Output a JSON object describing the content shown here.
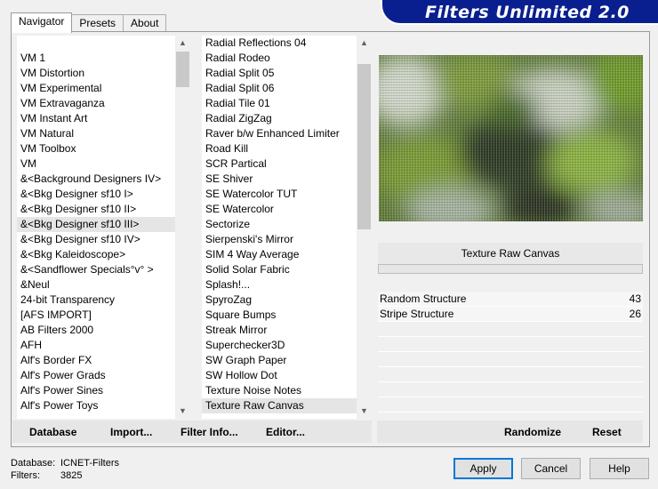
{
  "tabs": [
    "Navigator",
    "Presets",
    "About"
  ],
  "app_title": "Filters Unlimited 2.0",
  "categories": [
    "VM 1",
    "VM Distortion",
    "VM Experimental",
    "VM Extravaganza",
    "VM Instant Art",
    "VM Natural",
    "VM Toolbox",
    "VM",
    "&<Background Designers IV>",
    "&<Bkg Designer sf10 I>",
    "&<Bkg Designer sf10 II>",
    "&<Bkg Designer sf10 III>",
    "&<Bkg Designer sf10 IV>",
    "&<Bkg Kaleidoscope>",
    "&<Sandflower Specials°v° >",
    "&Neul",
    "24-bit Transparency",
    "[AFS IMPORT]",
    "AB Filters 2000",
    "AFH",
    "Alf's Border FX",
    "Alf's Power Grads",
    "Alf's Power Sines",
    "Alf's Power Toys"
  ],
  "selected_category": "&<Bkg Designer sf10 III>",
  "filters": [
    "Radial Reflections 04",
    "Radial Rodeo",
    "Radial Split 05",
    "Radial Split 06",
    "Radial Tile 01",
    "Radial ZigZag",
    "Raver b/w Enhanced Limiter",
    "Road Kill",
    "SCR  Partical",
    "SE Shiver",
    "SE Watercolor TUT",
    "SE Watercolor",
    "Sectorize",
    "Sierpenski's Mirror",
    "SIM 4 Way Average",
    "Solid Solar Fabric",
    "Splash!...",
    "SpyroZag",
    "Square Bumps",
    "Streak Mirror",
    "Superchecker3D",
    "SW Graph Paper",
    "SW Hollow Dot",
    "Texture Noise Notes",
    "Texture Raw Canvas"
  ],
  "selected_filter": "Texture Raw Canvas",
  "current_filter_name": "Texture Raw Canvas",
  "params": [
    {
      "name": "Random Structure",
      "value": "43"
    },
    {
      "name": "Stripe Structure",
      "value": "26"
    }
  ],
  "left_buttons": {
    "database": "Database",
    "import": "Import...",
    "filter_info": "Filter Info...",
    "editor": "Editor..."
  },
  "right_buttons": {
    "randomize": "Randomize",
    "reset": "Reset"
  },
  "footer": {
    "database_label": "Database:",
    "database_value": "ICNET-Filters",
    "filters_label": "Filters:",
    "filters_value": "3825"
  },
  "dialog_buttons": {
    "apply": "Apply",
    "cancel": "Cancel",
    "help": "Help"
  },
  "colors": {
    "banner": "#0a1f8f",
    "default_button_border": "#0078d7"
  },
  "icons": [
    "scroll-up-icon",
    "scroll-down-icon"
  ]
}
